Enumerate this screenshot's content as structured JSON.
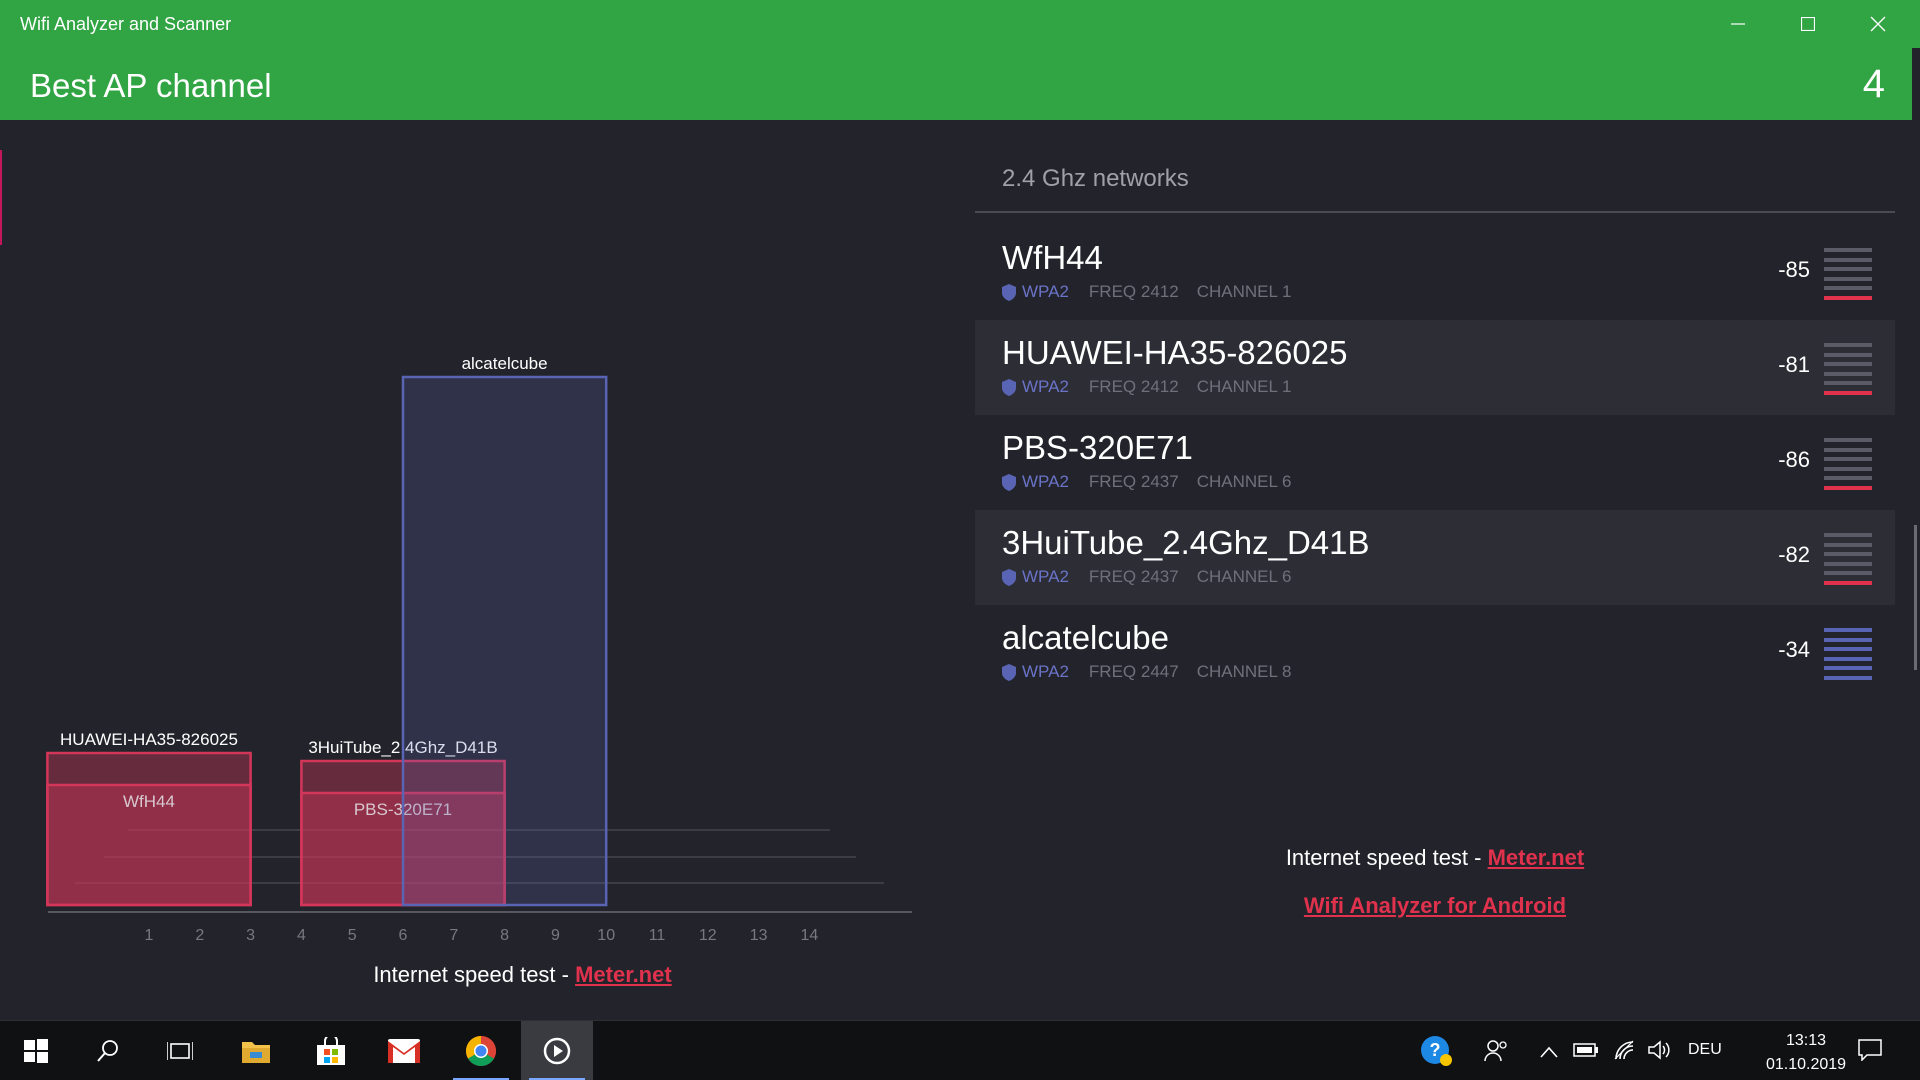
{
  "window": {
    "title": "Wifi Analyzer and Scanner",
    "minimize_icon": "minimize-icon",
    "maximize_icon": "maximize-icon",
    "close_icon": "close-icon"
  },
  "header": {
    "title": "Best AP channel",
    "best_channel": "4"
  },
  "chart_data": {
    "type": "bar",
    "xlabel": "",
    "ylabel": "",
    "categories": [
      "1",
      "2",
      "3",
      "4",
      "5",
      "6",
      "7",
      "8",
      "9",
      "10",
      "11",
      "12",
      "13",
      "14"
    ],
    "networks": [
      {
        "name": "HUAWEI-HA35-826025",
        "channel": 1,
        "signal": -81,
        "color": "#d4365a",
        "style": "band"
      },
      {
        "name": "WfH44",
        "channel": 1,
        "signal": -85,
        "color": "#d4365a",
        "style": "band"
      },
      {
        "name": "3HuiTube_2.4Ghz_D41B",
        "channel": 6,
        "signal": -82,
        "color": "#d4365a",
        "style": "band"
      },
      {
        "name": "PBS-320E71",
        "channel": 6,
        "signal": -86,
        "color": "#d4365a",
        "style": "band"
      },
      {
        "name": "alcatelcube",
        "channel": 8,
        "signal": -34,
        "color": "#5a64b4",
        "style": "band"
      }
    ],
    "grid": true,
    "legend": "none"
  },
  "networks_panel": {
    "section_title": "2.4 Ghz networks",
    "networks": [
      {
        "name": "WfH44",
        "security": "WPA2",
        "freq": "FREQ 2412",
        "channel": "CHANNEL 1",
        "signal": "-85",
        "level": 1,
        "color": "#e0314d"
      },
      {
        "name": "HUAWEI-HA35-826025",
        "security": "WPA2",
        "freq": "FREQ 2412",
        "channel": "CHANNEL 1",
        "signal": "-81",
        "level": 1,
        "color": "#e0314d"
      },
      {
        "name": "PBS-320E71",
        "security": "WPA2",
        "freq": "FREQ 2437",
        "channel": "CHANNEL 6",
        "signal": "-86",
        "level": 1,
        "color": "#e0314d"
      },
      {
        "name": "3HuiTube_2.4Ghz_D41B",
        "security": "WPA2",
        "freq": "FREQ 2437",
        "channel": "CHANNEL 6",
        "signal": "-82",
        "level": 1,
        "color": "#e0314d"
      },
      {
        "name": "alcatelcube",
        "security": "WPA2",
        "freq": "FREQ 2447",
        "channel": "CHANNEL 8",
        "signal": "-34",
        "level": 6,
        "color": "#5a64b4"
      }
    ]
  },
  "links": {
    "speed_test_prefix": "Internet speed test - ",
    "speed_test_link": "Meter.net",
    "android_link": "Wifi Analyzer for Android"
  },
  "taskbar": {
    "items": [
      "windows-start-icon",
      "search-icon",
      "task-view-icon",
      "file-explorer-icon",
      "store-icon",
      "gmail-icon",
      "chrome-icon",
      "wifi-analyzer-icon"
    ],
    "language": "DEU",
    "time": "13:13",
    "date": "01.10.2019"
  },
  "colors": {
    "accent_green": "#31a443",
    "weak_red": "#e0314d",
    "strong_blue": "#5a64b4",
    "background": "#23242b"
  }
}
